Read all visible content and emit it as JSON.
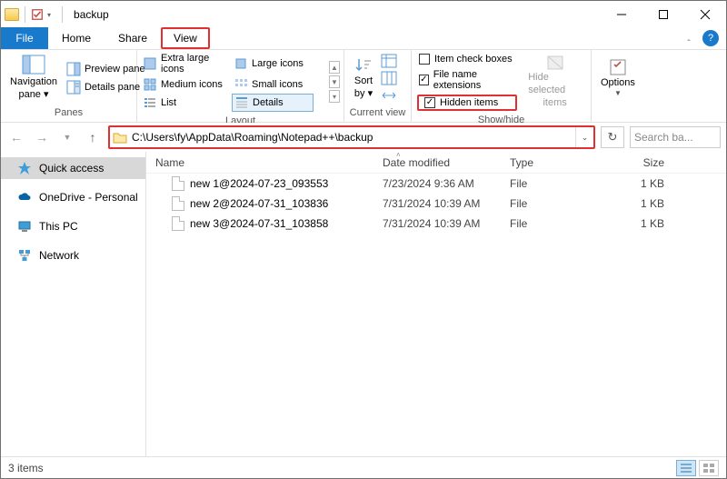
{
  "window": {
    "title": "backup"
  },
  "tabs": {
    "file": "File",
    "home": "Home",
    "share": "Share",
    "view": "View"
  },
  "ribbon": {
    "panes": {
      "navigation": "Navigation",
      "navigation2": "pane",
      "preview": "Preview pane",
      "details": "Details pane",
      "label": "Panes"
    },
    "layout": {
      "xl": "Extra large icons",
      "large": "Large icons",
      "medium": "Medium icons",
      "small": "Small icons",
      "list": "List",
      "details": "Details",
      "label": "Layout"
    },
    "currentview": {
      "sort": "Sort",
      "sort2": "by",
      "label": "Current view"
    },
    "showhide": {
      "itemcheck": "Item check boxes",
      "ext": "File name extensions",
      "hidden": "Hidden items",
      "hidesel1": "Hide selected",
      "hidesel2": "items",
      "label": "Show/hide"
    },
    "options": {
      "label": "Options"
    }
  },
  "address": {
    "path": "C:\\Users\\fy\\AppData\\Roaming\\Notepad++\\backup"
  },
  "search": {
    "placeholder": "Search ba..."
  },
  "columns": {
    "name": "Name",
    "date": "Date modified",
    "type": "Type",
    "size": "Size"
  },
  "sidebar": {
    "quick": "Quick access",
    "onedrive": "OneDrive - Personal",
    "thispc": "This PC",
    "network": "Network"
  },
  "files": [
    {
      "name": "new 1@2024-07-23_093553",
      "date": "7/23/2024 9:36 AM",
      "type": "File",
      "size": "1 KB"
    },
    {
      "name": "new 2@2024-07-31_103836",
      "date": "7/31/2024 10:39 AM",
      "type": "File",
      "size": "1 KB"
    },
    {
      "name": "new 3@2024-07-31_103858",
      "date": "7/31/2024 10:39 AM",
      "type": "File",
      "size": "1 KB"
    }
  ],
  "status": {
    "count": "3 items"
  }
}
